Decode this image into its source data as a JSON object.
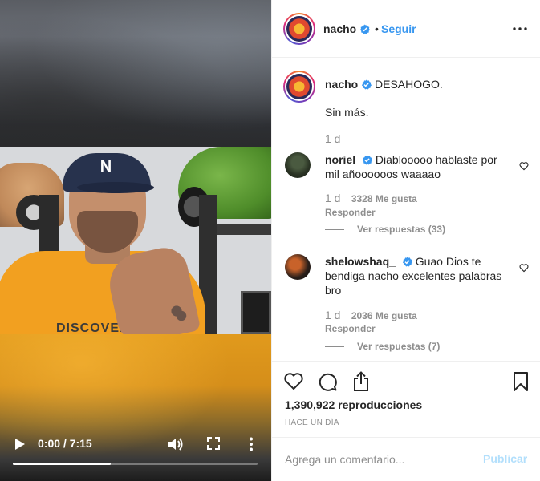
{
  "video": {
    "shirt_text": "DISCOVERE",
    "current_time": "0:00",
    "duration": "7:15",
    "time_display": "0:00 / 7:15",
    "progress_fraction": 0.4
  },
  "header": {
    "username": "nacho",
    "follow_label": "Seguir",
    "dot": "•"
  },
  "caption": {
    "username": "nacho",
    "text": "DESAHOGO.",
    "line2": "Sin más.",
    "time": "1 d"
  },
  "comments": [
    {
      "username": "noriel",
      "text": "Diablooooo hablaste por mil añoooooos waaaao",
      "time": "1 d",
      "likes": "3328 Me gusta",
      "reply_label": "Responder",
      "view_replies": "Ver respuestas (33)"
    },
    {
      "username": "shelowshaq_",
      "text": "Guao Dios te bendiga nacho excelentes palabras bro",
      "time": "1 d",
      "likes": "2036 Me gusta",
      "reply_label": "Responder",
      "view_replies": "Ver respuestas (7)"
    }
  ],
  "stats": {
    "views": "1,390,922 reproducciones",
    "date": "HACE UN DÍA"
  },
  "composer": {
    "placeholder": "Agrega un comentario...",
    "post_label": "Publicar"
  },
  "colors": {
    "link_blue": "#3897f0",
    "post_disabled": "#b2dffc",
    "verified_blue": "#3897f0",
    "muted": "#8e8e8e"
  },
  "icons": {
    "play": "play-icon",
    "volume": "volume-icon",
    "fullscreen": "fullscreen-icon",
    "video_menu": "more-vertical-icon",
    "more": "more-horizontal-icon",
    "verified": "verified-badge-icon",
    "like": "heart-icon",
    "comment": "comment-icon",
    "share": "share-icon",
    "save": "bookmark-icon"
  }
}
